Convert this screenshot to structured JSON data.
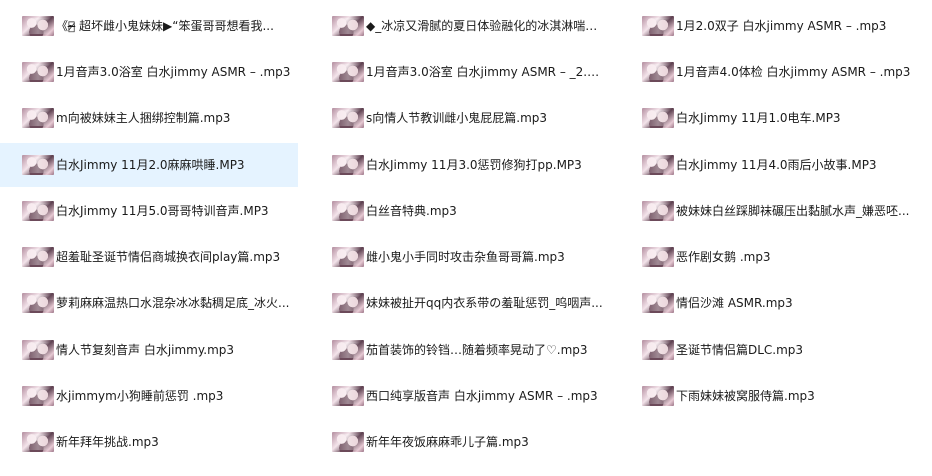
{
  "files": [
    {
      "name": "《ఌ̴̶̷ 超坏雌小鬼妹妹▶“笨蛋哥哥想看我..."
    },
    {
      "name": "◆_冰凉又滑腻的夏日体验融化的冰淇淋喘息..."
    },
    {
      "name": "1月2.0双子 白水jimmy ASMR – .mp3"
    },
    {
      "name": "1月音声3.0浴室 白水jimmy ASMR – .mp3"
    },
    {
      "name": "1月音声3.0浴室 白水jimmy ASMR – _2.m..."
    },
    {
      "name": "1月音声4.0体检 白水jimmy ASMR – .mp3"
    },
    {
      "name": "m向被妹妹主人捆绑控制篇.mp3"
    },
    {
      "name": "s向情人节教训雌小鬼屁屁篇.mp3"
    },
    {
      "name": "白水Jimmy 11月1.0电车.MP3"
    },
    {
      "name": "白水Jimmy 11月2.0麻麻哄睡.MP3"
    },
    {
      "name": "白水Jimmy 11月3.0惩罚修狗打pp.MP3"
    },
    {
      "name": "白水Jimmy 11月4.0雨后小故事.MP3"
    },
    {
      "name": "白水Jimmy 11月5.0哥哥特训音声.MP3"
    },
    {
      "name": "白丝音特典.mp3"
    },
    {
      "name": "被妹妹白丝踩脚袜碾压出黏腻水声_嫌恶呸..."
    },
    {
      "name": "超羞耻圣诞节情侣商城换衣间play篇.mp3"
    },
    {
      "name": "雌小鬼小手同时攻击杂鱼哥哥篇.mp3"
    },
    {
      "name": "恶作剧女鹅 .mp3"
    },
    {
      "name": "萝莉麻麻温热口水混杂冰冰黏稠足底_冰火..."
    },
    {
      "name": "妹妹被扯开qq内衣系带の羞耻惩罚_呜咽声..."
    },
    {
      "name": "情侣沙滩 ASMR.mp3"
    },
    {
      "name": "情人节复刻音声 白水jimmy.mp3"
    },
    {
      "name": "茄首装饰的铃铛…随着频率晃动了♡.mp3"
    },
    {
      "name": "圣诞节情侣篇DLC.mp3"
    },
    {
      "name": "水jimmym小狗睡前惩罚 .mp3"
    },
    {
      "name": "西口纯享版音声 白水jimmy ASMR – .mp3"
    },
    {
      "name": "下雨妹妹被窝服侍篇.mp3"
    },
    {
      "name": "新年拜年挑战.mp3"
    },
    {
      "name": "新年年夜饭麻麻乖儿子篇.mp3"
    }
  ],
  "selected_file": "白水Jimmy 11月2.0麻麻哄睡.MP3",
  "thumbnail_icon": "audio-cover-thumbnail-icon",
  "colors": {
    "selection_background": "#e5f3ff",
    "text": "#1a1a1a",
    "background": "#ffffff"
  }
}
